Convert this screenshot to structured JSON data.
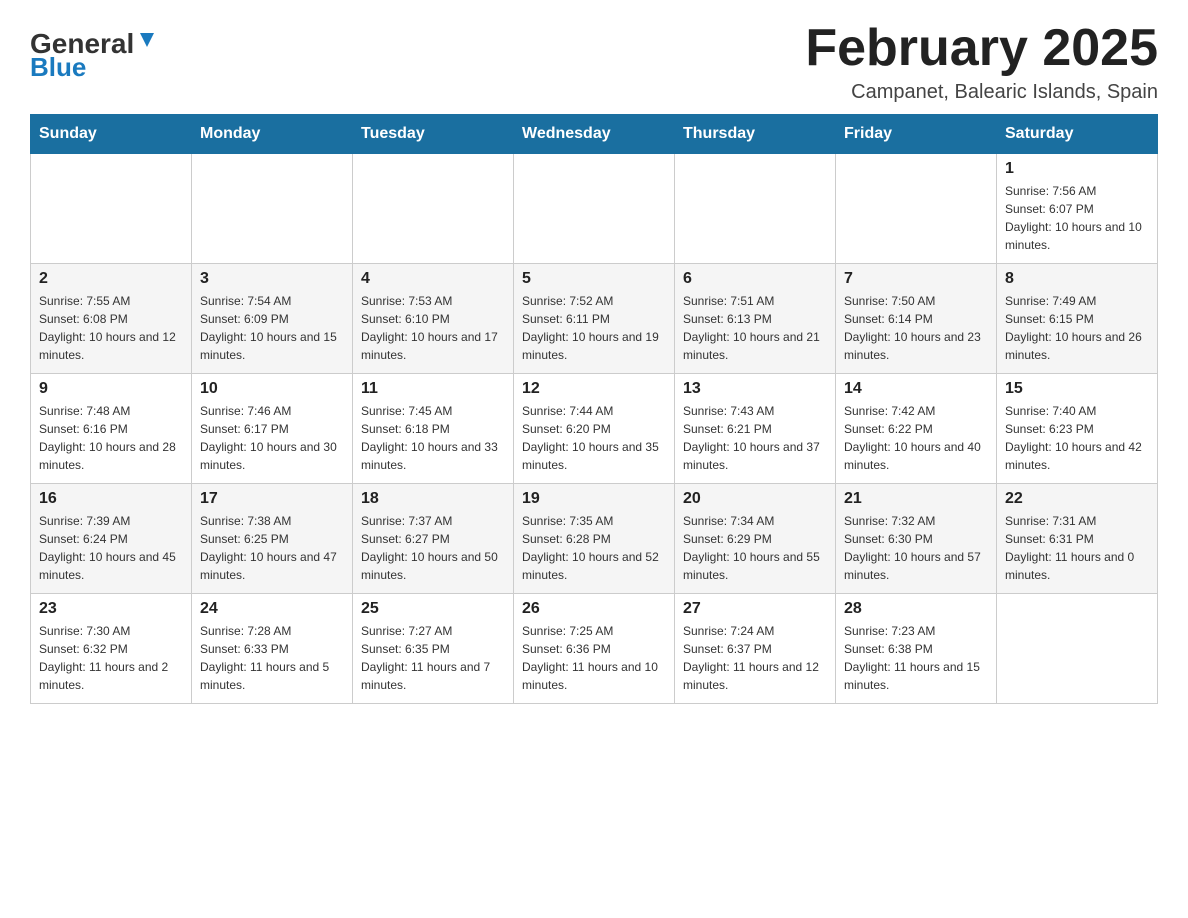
{
  "logo": {
    "general": "General",
    "blue": "Blue"
  },
  "header": {
    "title": "February 2025",
    "subtitle": "Campanet, Balearic Islands, Spain"
  },
  "days_of_week": [
    "Sunday",
    "Monday",
    "Tuesday",
    "Wednesday",
    "Thursday",
    "Friday",
    "Saturday"
  ],
  "weeks": [
    [
      {
        "day": "",
        "info": ""
      },
      {
        "day": "",
        "info": ""
      },
      {
        "day": "",
        "info": ""
      },
      {
        "day": "",
        "info": ""
      },
      {
        "day": "",
        "info": ""
      },
      {
        "day": "",
        "info": ""
      },
      {
        "day": "1",
        "info": "Sunrise: 7:56 AM\nSunset: 6:07 PM\nDaylight: 10 hours and 10 minutes."
      }
    ],
    [
      {
        "day": "2",
        "info": "Sunrise: 7:55 AM\nSunset: 6:08 PM\nDaylight: 10 hours and 12 minutes."
      },
      {
        "day": "3",
        "info": "Sunrise: 7:54 AM\nSunset: 6:09 PM\nDaylight: 10 hours and 15 minutes."
      },
      {
        "day": "4",
        "info": "Sunrise: 7:53 AM\nSunset: 6:10 PM\nDaylight: 10 hours and 17 minutes."
      },
      {
        "day": "5",
        "info": "Sunrise: 7:52 AM\nSunset: 6:11 PM\nDaylight: 10 hours and 19 minutes."
      },
      {
        "day": "6",
        "info": "Sunrise: 7:51 AM\nSunset: 6:13 PM\nDaylight: 10 hours and 21 minutes."
      },
      {
        "day": "7",
        "info": "Sunrise: 7:50 AM\nSunset: 6:14 PM\nDaylight: 10 hours and 23 minutes."
      },
      {
        "day": "8",
        "info": "Sunrise: 7:49 AM\nSunset: 6:15 PM\nDaylight: 10 hours and 26 minutes."
      }
    ],
    [
      {
        "day": "9",
        "info": "Sunrise: 7:48 AM\nSunset: 6:16 PM\nDaylight: 10 hours and 28 minutes."
      },
      {
        "day": "10",
        "info": "Sunrise: 7:46 AM\nSunset: 6:17 PM\nDaylight: 10 hours and 30 minutes."
      },
      {
        "day": "11",
        "info": "Sunrise: 7:45 AM\nSunset: 6:18 PM\nDaylight: 10 hours and 33 minutes."
      },
      {
        "day": "12",
        "info": "Sunrise: 7:44 AM\nSunset: 6:20 PM\nDaylight: 10 hours and 35 minutes."
      },
      {
        "day": "13",
        "info": "Sunrise: 7:43 AM\nSunset: 6:21 PM\nDaylight: 10 hours and 37 minutes."
      },
      {
        "day": "14",
        "info": "Sunrise: 7:42 AM\nSunset: 6:22 PM\nDaylight: 10 hours and 40 minutes."
      },
      {
        "day": "15",
        "info": "Sunrise: 7:40 AM\nSunset: 6:23 PM\nDaylight: 10 hours and 42 minutes."
      }
    ],
    [
      {
        "day": "16",
        "info": "Sunrise: 7:39 AM\nSunset: 6:24 PM\nDaylight: 10 hours and 45 minutes."
      },
      {
        "day": "17",
        "info": "Sunrise: 7:38 AM\nSunset: 6:25 PM\nDaylight: 10 hours and 47 minutes."
      },
      {
        "day": "18",
        "info": "Sunrise: 7:37 AM\nSunset: 6:27 PM\nDaylight: 10 hours and 50 minutes."
      },
      {
        "day": "19",
        "info": "Sunrise: 7:35 AM\nSunset: 6:28 PM\nDaylight: 10 hours and 52 minutes."
      },
      {
        "day": "20",
        "info": "Sunrise: 7:34 AM\nSunset: 6:29 PM\nDaylight: 10 hours and 55 minutes."
      },
      {
        "day": "21",
        "info": "Sunrise: 7:32 AM\nSunset: 6:30 PM\nDaylight: 10 hours and 57 minutes."
      },
      {
        "day": "22",
        "info": "Sunrise: 7:31 AM\nSunset: 6:31 PM\nDaylight: 11 hours and 0 minutes."
      }
    ],
    [
      {
        "day": "23",
        "info": "Sunrise: 7:30 AM\nSunset: 6:32 PM\nDaylight: 11 hours and 2 minutes."
      },
      {
        "day": "24",
        "info": "Sunrise: 7:28 AM\nSunset: 6:33 PM\nDaylight: 11 hours and 5 minutes."
      },
      {
        "day": "25",
        "info": "Sunrise: 7:27 AM\nSunset: 6:35 PM\nDaylight: 11 hours and 7 minutes."
      },
      {
        "day": "26",
        "info": "Sunrise: 7:25 AM\nSunset: 6:36 PM\nDaylight: 11 hours and 10 minutes."
      },
      {
        "day": "27",
        "info": "Sunrise: 7:24 AM\nSunset: 6:37 PM\nDaylight: 11 hours and 12 minutes."
      },
      {
        "day": "28",
        "info": "Sunrise: 7:23 AM\nSunset: 6:38 PM\nDaylight: 11 hours and 15 minutes."
      },
      {
        "day": "",
        "info": ""
      }
    ]
  ]
}
